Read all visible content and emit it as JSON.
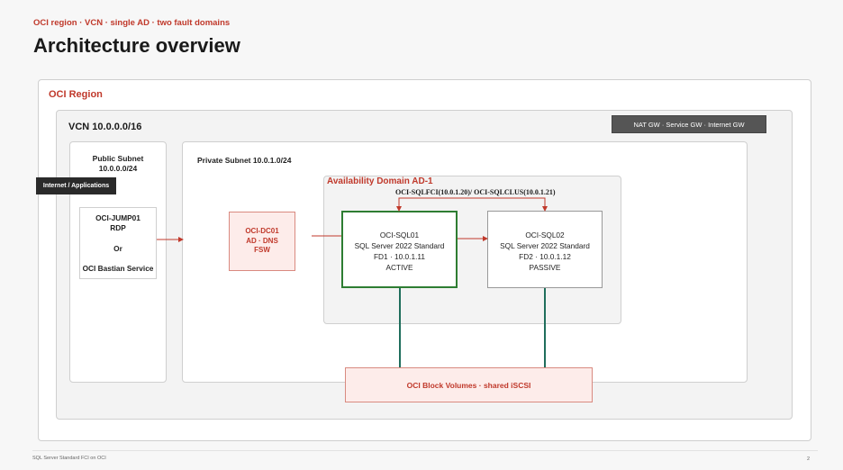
{
  "header": {
    "kicker": "OCI region · VCN · single AD · two fault domains",
    "title": "Architecture overview"
  },
  "diagram": {
    "region_label": "OCI Region",
    "vcn_label": "VCN 10.0.0.0/16",
    "gateways_label": "NAT GW · Service GW · Internet GW",
    "public_subnet": {
      "line1": "Public Subnet",
      "line2": "10.0.0.0/24"
    },
    "internet_label": "Internet / Applications",
    "jump_box": {
      "line1": "OCI-JUMP01",
      "line2": "RDP",
      "line3": "Or",
      "line4": "OCI Bastian Service"
    },
    "private_subnet_label": "Private Subnet 10.0.1.0/24",
    "ad_label": "Availability Domain AD-1",
    "fci_label": "OCI-SQLFCI(10.0.1.20)/ OCI-SQLCLUS(10.0.1.21)",
    "dc": {
      "line1": "OCI-DC01",
      "line2": "AD · DNS",
      "line3": "FSW"
    },
    "sql01": {
      "name": "OCI-SQL01",
      "edition": "SQL Server 2022 Standard",
      "fd": "FD1 · 10.0.1.11",
      "role": "ACTIVE"
    },
    "sql02": {
      "name": "OCI-SQL02",
      "edition": "SQL Server 2022 Standard",
      "fd": "FD2 · 10.0.1.12",
      "role": "PASSIVE"
    },
    "storage_label": "OCI Block Volumes · shared iSCSI"
  },
  "footer": {
    "text": "SQL Server Standard FCI on OCI",
    "page": "2"
  },
  "colors": {
    "accent_red": "#c0392b",
    "active_green": "#2e7d32",
    "storage_link": "#1f6e5c"
  }
}
